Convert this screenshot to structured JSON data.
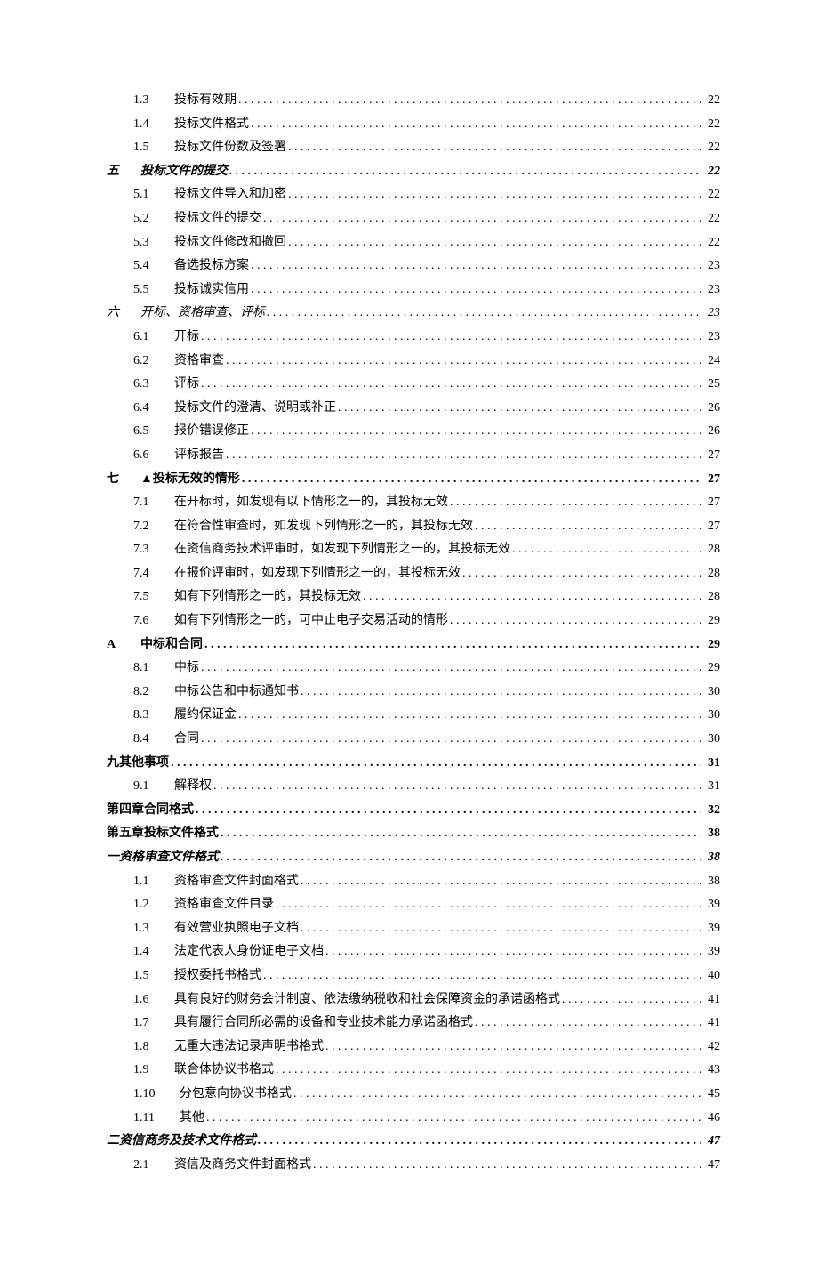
{
  "toc": [
    {
      "type": "sub",
      "num": "1.3",
      "label": "投标有效期",
      "page": "22"
    },
    {
      "type": "sub",
      "num": "1.4",
      "label": "投标文件格式",
      "page": "22"
    },
    {
      "type": "sub",
      "num": "1.5",
      "label": "投标文件份数及签署",
      "page": "22"
    },
    {
      "type": "sec",
      "num": "五",
      "label": "投标文件的提交",
      "page": "22",
      "bold": true,
      "italic": true
    },
    {
      "type": "sub",
      "num": "5.1",
      "label": "投标文件导入和加密",
      "page": "22"
    },
    {
      "type": "sub",
      "num": "5.2",
      "label": "投标文件的提交",
      "page": "22"
    },
    {
      "type": "sub",
      "num": "5.3",
      "label": "投标文件修改和撤回",
      "page": "22"
    },
    {
      "type": "sub",
      "num": "5.4",
      "label": "备选投标方案",
      "page": "23"
    },
    {
      "type": "sub",
      "num": "5.5",
      "label": "投标诚实信用",
      "page": "23"
    },
    {
      "type": "sec",
      "num": "六",
      "label": "开标、资格审查、评标",
      "page": "23",
      "italic": true
    },
    {
      "type": "sub",
      "num": "6.1",
      "label": "开标",
      "page": "23"
    },
    {
      "type": "sub",
      "num": "6.2",
      "label": "资格审查",
      "page": "24"
    },
    {
      "type": "sub",
      "num": "6.3",
      "label": "评标",
      "page": "25"
    },
    {
      "type": "sub",
      "num": "6.4",
      "label": "投标文件的澄清、说明或补正",
      "page": "26"
    },
    {
      "type": "sub",
      "num": "6.5",
      "label": "报价错误修正",
      "page": "26"
    },
    {
      "type": "sub",
      "num": "6.6",
      "label": "评标报告",
      "page": "27"
    },
    {
      "type": "sec",
      "num": "七",
      "label": "▲投标无效的情形",
      "page": "27",
      "bold": true
    },
    {
      "type": "sub",
      "num": "7.1",
      "label": "在开标时，如发现有以下情形之一的，其投标无效",
      "page": "27"
    },
    {
      "type": "sub",
      "num": "7.2",
      "label": "在符合性审查时，如发现下列情形之一的，其投标无效",
      "page": "27"
    },
    {
      "type": "sub",
      "num": "7.3",
      "label": "在资信商务技术评审时，如发现下列情形之一的，其投标无效",
      "page": "28"
    },
    {
      "type": "sub",
      "num": "7.4",
      "label": "在报价评审时，如发现下列情形之一的，其投标无效",
      "page": "28"
    },
    {
      "type": "sub",
      "num": "7.5",
      "label": "如有下列情形之一的，其投标无效",
      "page": "28"
    },
    {
      "type": "sub",
      "num": "7.6",
      "label": "如有下列情形之一的，可中止电子交易活动的情形",
      "page": "29"
    },
    {
      "type": "sec",
      "num": "A",
      "label": "中标和合同",
      "page": "29",
      "bold": true
    },
    {
      "type": "sub",
      "num": "8.1",
      "label": "中标",
      "page": "29"
    },
    {
      "type": "sub",
      "num": "8.2",
      "label": "中标公告和中标通知书",
      "page": "30"
    },
    {
      "type": "sub",
      "num": "8.3",
      "label": "履约保证金",
      "page": "30"
    },
    {
      "type": "sub",
      "num": "8.4",
      "label": "合同",
      "page": "30"
    },
    {
      "type": "sec",
      "num": "",
      "label": "九其他事项",
      "page": "31",
      "bold": true
    },
    {
      "type": "sub",
      "num": "9.1",
      "label": "解释权",
      "page": "31"
    },
    {
      "type": "chap",
      "num": "",
      "label": "第四章合同格式",
      "page": "32",
      "bold": true
    },
    {
      "type": "chap",
      "num": "",
      "label": "第五章投标文件格式",
      "page": "38",
      "bold": true
    },
    {
      "type": "sec",
      "num": "",
      "label": "一资格审查文件格式",
      "page": "38",
      "bold": true,
      "italic": true
    },
    {
      "type": "sub",
      "num": "1.1",
      "label": "资格审查文件封面格式",
      "page": "38"
    },
    {
      "type": "sub",
      "num": "1.2",
      "label": "资格审查文件目录",
      "page": "39"
    },
    {
      "type": "sub",
      "num": "1.3",
      "label": "有效营业执照电子文档",
      "page": "39"
    },
    {
      "type": "sub",
      "num": "1.4",
      "label": "法定代表人身份证电子文档",
      "page": "39"
    },
    {
      "type": "sub",
      "num": "1.5",
      "label": "授权委托书格式",
      "page": "40"
    },
    {
      "type": "sub",
      "num": "1.6",
      "label": "具有良好的财务会计制度、依法缴纳税收和社会保障资金的承诺函格式",
      "page": "41"
    },
    {
      "type": "sub",
      "num": "1.7",
      "label": "具有履行合同所必需的设备和专业技术能力承诺函格式",
      "page": "41"
    },
    {
      "type": "sub",
      "num": "1.8",
      "label": "无重大违法记录声明书格式",
      "page": "42"
    },
    {
      "type": "sub",
      "num": "1.9",
      "label": "联合体协议书格式",
      "page": "43"
    },
    {
      "type": "sub",
      "num": "1.10",
      "label": "分包意向协议书格式",
      "page": "45"
    },
    {
      "type": "sub",
      "num": "1.11",
      "label": "其他",
      "page": "46"
    },
    {
      "type": "sec",
      "num": "",
      "label": "二资信商务及技术文件格式",
      "page": "47",
      "bold": true,
      "italic": true
    },
    {
      "type": "sub",
      "num": "2.1",
      "label": "资信及商务文件封面格式",
      "page": "47"
    }
  ]
}
